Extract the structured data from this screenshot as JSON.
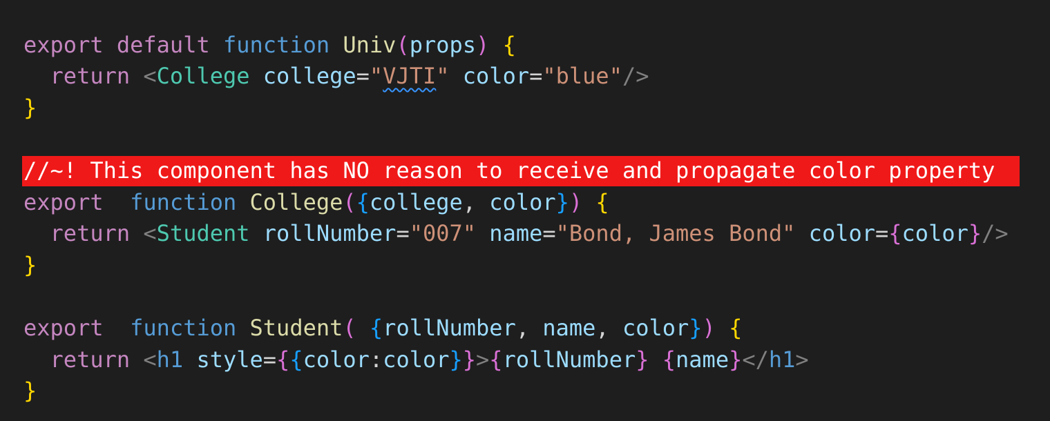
{
  "code": {
    "kw_export": "export",
    "kw_default": "default",
    "kw_function": "function",
    "kw_return": "return",
    "univ_fn": "Univ",
    "props_param": "props",
    "college_tag": "College",
    "college_attr": "college",
    "college_value": "\"VJTI\"",
    "color_attr": "color",
    "color_value": "\"blue\"",
    "comment": "//~! This component has NO reason to receive and propagate color property",
    "college_fn": "College",
    "college_param": "college",
    "color_param": "color",
    "student_tag": "Student",
    "rollnumber_attr": "rollNumber",
    "rollnumber_value": "\"007\"",
    "name_attr": "name",
    "name_value": "\"Bond, James Bond\"",
    "student_fn": "Student",
    "rollnumber_param": "rollNumber",
    "name_param": "name",
    "h1_tag": "h1",
    "style_attr": "style",
    "style_key": "color",
    "style_value": "color"
  }
}
